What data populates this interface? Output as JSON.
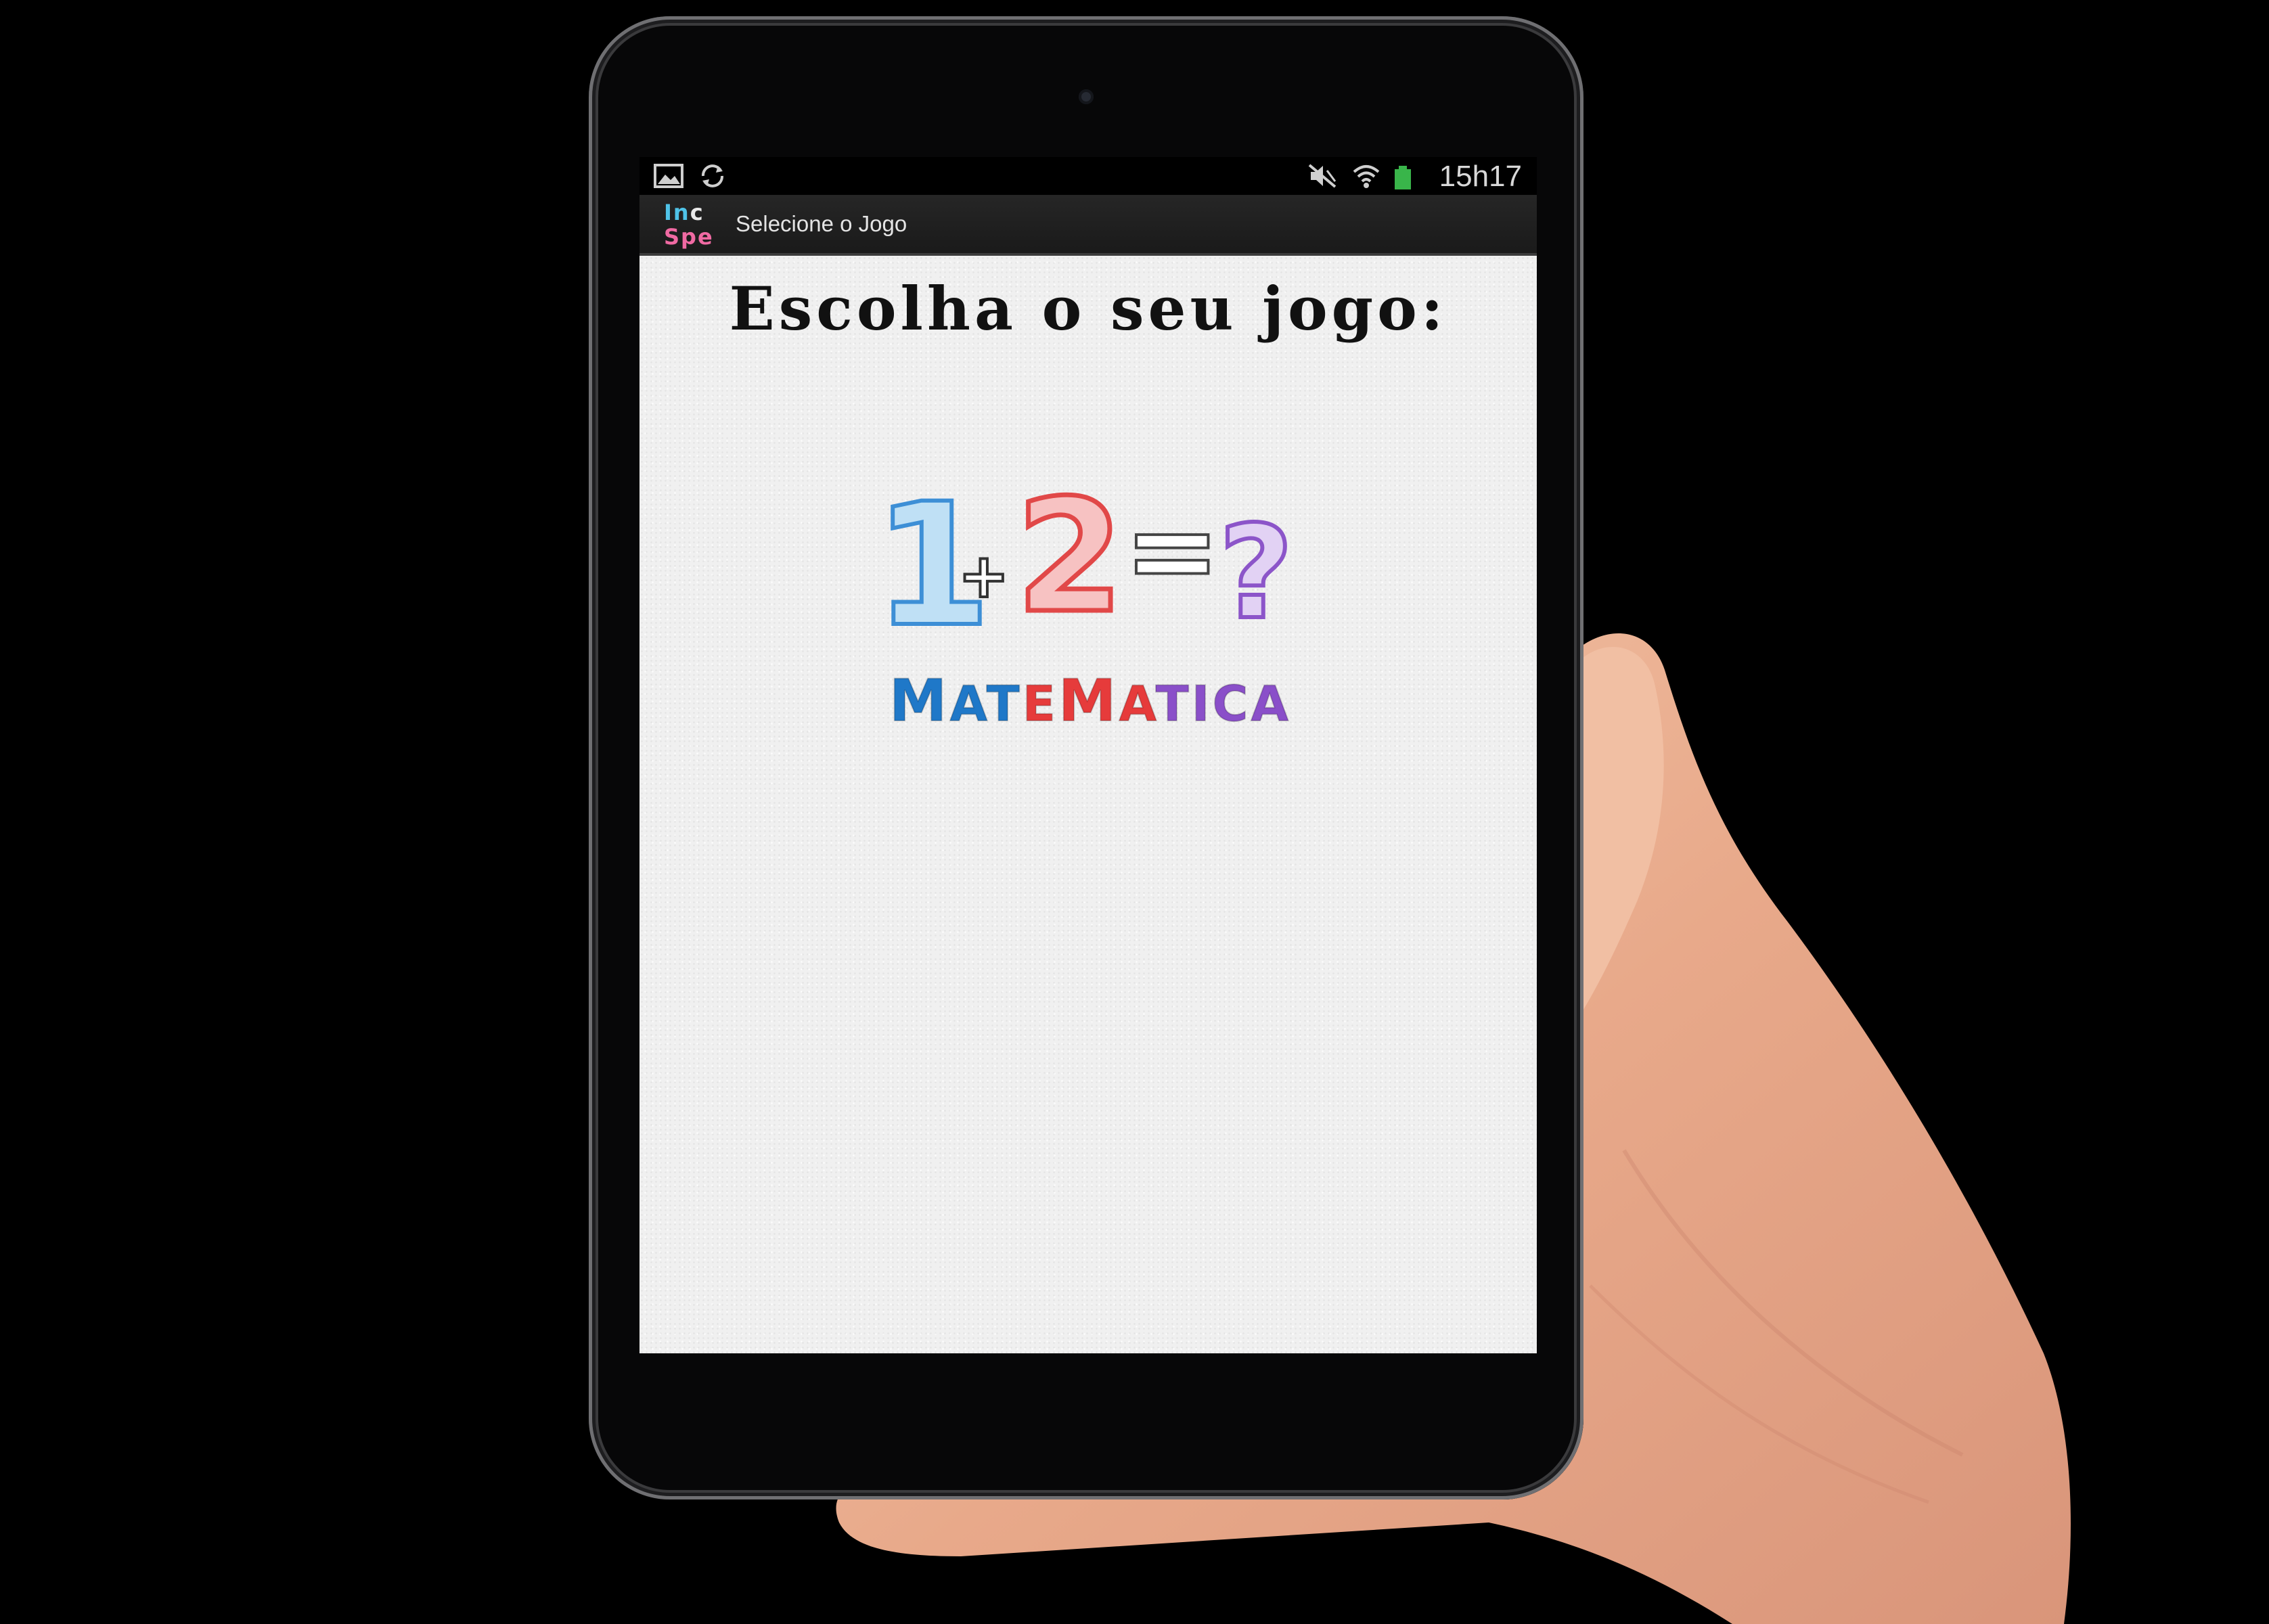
{
  "status_bar": {
    "time": "15h17",
    "icons": [
      "image-icon",
      "sync-icon",
      "mute-icon",
      "wifi-icon",
      "battery-icon"
    ]
  },
  "action_bar": {
    "logo_line1": [
      "I",
      "n",
      "c"
    ],
    "logo_line2": [
      "S",
      "p",
      "e"
    ],
    "title": "Selecione o Jogo"
  },
  "content": {
    "headline": "Escolha o seu jogo:",
    "game": {
      "equation": {
        "n1": "1",
        "plus": "+",
        "n2": "2",
        "equals": "=",
        "question": "?"
      },
      "name_letters": [
        "M",
        "A",
        "T",
        "E",
        "M",
        "A",
        "T",
        "I",
        "C",
        "A"
      ],
      "name_colors": [
        "#1f78c8",
        "#1f78c8",
        "#1f78c8",
        "#e63b3b",
        "#e63b3b",
        "#e63b3b",
        "#8a4fc9",
        "#8a4fc9",
        "#8a4fc9",
        "#8a4fc9"
      ]
    }
  },
  "colors": {
    "blue": "#3d8fd6",
    "red": "#e14848",
    "purple": "#8c55c9",
    "logo_cyan": "#4fc3e8",
    "logo_pink": "#f06aa3"
  }
}
